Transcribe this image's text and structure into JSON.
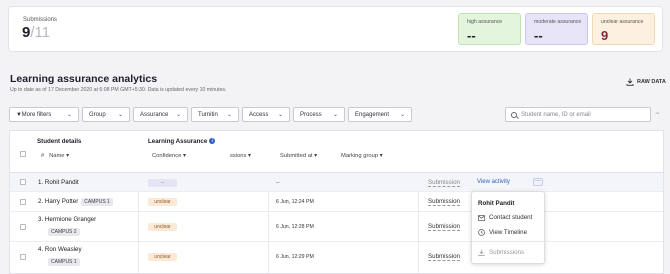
{
  "summary": {
    "submissions_label": "Submissions",
    "submissions_count": "9",
    "submissions_total": "/11",
    "tiles": [
      {
        "label": "high assurance",
        "value": "--"
      },
      {
        "label": "moderate assurance",
        "value": "--"
      },
      {
        "label": "unclear assurance",
        "value": "9"
      }
    ]
  },
  "page": {
    "title": "Learning assurance analytics",
    "updated": "Up to date as of 17 December 2020 at 6:08 PM GMT+5:30. Data is updated every 10 minutes.",
    "raw_data": "RAW DATA"
  },
  "filters": {
    "more": "More filters",
    "items": [
      "Group",
      "Assurance",
      "Turnitin",
      "Access",
      "Process",
      "Engagement"
    ],
    "search_placeholder": "Student name, ID or email"
  },
  "table": {
    "student_details": "Student details",
    "name_col": "Name",
    "learning_assurance": "Learning Assurance",
    "confidence_col": "Confidence",
    "sessions_col": "ssions",
    "submitted_col": "Submitted at",
    "marking_col": "Marking group",
    "rows": [
      {
        "num": "1.",
        "name": "Rohit Pandit",
        "campus": "",
        "confidence": "--",
        "date": "--",
        "submission": "Submission",
        "action": "View activity"
      },
      {
        "num": "2.",
        "name": "Harry Potter",
        "campus": "CAMPUS 1",
        "confidence": "unclear",
        "date": "6 Jun, 12:24 PM",
        "submission": "Submission",
        "action": ""
      },
      {
        "num": "3.",
        "name": "Hermione Granger",
        "campus": "CAMPUS 2",
        "confidence": "unclear",
        "date": "6 Jun, 12:28 PM",
        "submission": "Submission",
        "action": ""
      },
      {
        "num": "4.",
        "name": "Ron Weasley",
        "campus": "CAMPUS 1",
        "confidence": "unclear",
        "date": "6 Jun, 12:29 PM",
        "submission": "Submission",
        "action": ""
      }
    ]
  },
  "menu": {
    "title": "Rohit Pandit",
    "contact": "Contact student",
    "timeline": "View Timeline",
    "submissions": "Submissions"
  }
}
